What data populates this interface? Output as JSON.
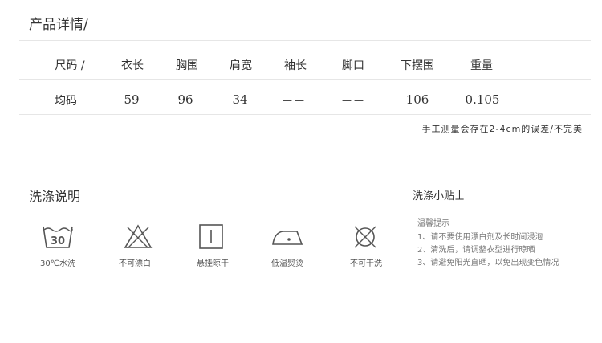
{
  "header": {
    "title": "产品详情/"
  },
  "size_table": {
    "columns": [
      "尺码 /",
      "衣长",
      "胸围",
      "肩宽",
      "袖长",
      "脚口",
      "下摆围",
      "重量"
    ],
    "row": [
      "均码",
      "59",
      "96",
      "34",
      "——",
      "——",
      "106",
      "0.105"
    ]
  },
  "measure_note": "手工测量会存在2-4cm的误差/不完美",
  "wash": {
    "title": "洗涤说明",
    "icons": [
      {
        "name": "wash-30-icon",
        "label": "30℃水洗",
        "text": "30"
      },
      {
        "name": "no-bleach-icon",
        "label": "不可漂白"
      },
      {
        "name": "hang-dry-icon",
        "label": "悬挂晾干"
      },
      {
        "name": "low-iron-icon",
        "label": "低温熨烫"
      },
      {
        "name": "no-dry-clean-icon",
        "label": "不可干洗"
      }
    ]
  },
  "tips": {
    "title": "洗涤小贴士",
    "subtitle": "温馨提示",
    "items": [
      "1、请不要使用漂白剂及长时间浸泡",
      "2、清洗后，请调整衣型进行晾晒",
      "3、请避免阳光直晒，以免出现变色情况"
    ]
  },
  "colors": {
    "text": "#333333",
    "line": "#e6e6e6",
    "icon": "#555555"
  }
}
